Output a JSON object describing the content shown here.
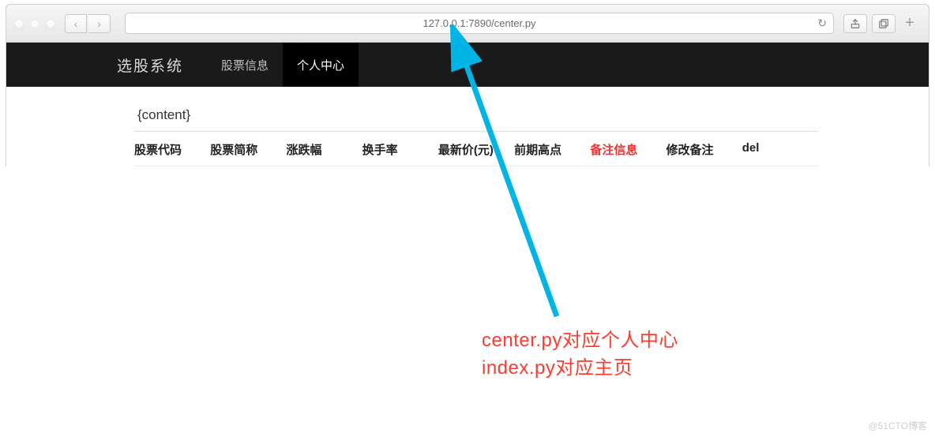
{
  "browser": {
    "url": "127.0.0.1:7890/center.py",
    "back_icon": "‹",
    "forward_icon": "›",
    "reload_icon": "↻",
    "share_icon": "⇪",
    "tabs_icon": "⧉",
    "new_tab_icon": "+"
  },
  "navbar": {
    "brand": "选股系统",
    "items": [
      {
        "label": "股票信息",
        "active": false
      },
      {
        "label": "个人中心",
        "active": true
      }
    ]
  },
  "content": {
    "placeholder": "{content}",
    "columns": [
      {
        "label": "股票代码",
        "highlight": false
      },
      {
        "label": "股票简称",
        "highlight": false
      },
      {
        "label": "涨跌幅",
        "highlight": false
      },
      {
        "label": "换手率",
        "highlight": false
      },
      {
        "label": "最新价(元)",
        "highlight": false
      },
      {
        "label": "前期高点",
        "highlight": false
      },
      {
        "label": "备注信息",
        "highlight": true
      },
      {
        "label": "修改备注",
        "highlight": false
      },
      {
        "label": "del",
        "highlight": false
      }
    ]
  },
  "annotation": {
    "line1": "center.py对应个人中心",
    "line2": "index.py对应主页",
    "arrow_color": "#00b4e6"
  },
  "watermark": "@51CTO博客"
}
